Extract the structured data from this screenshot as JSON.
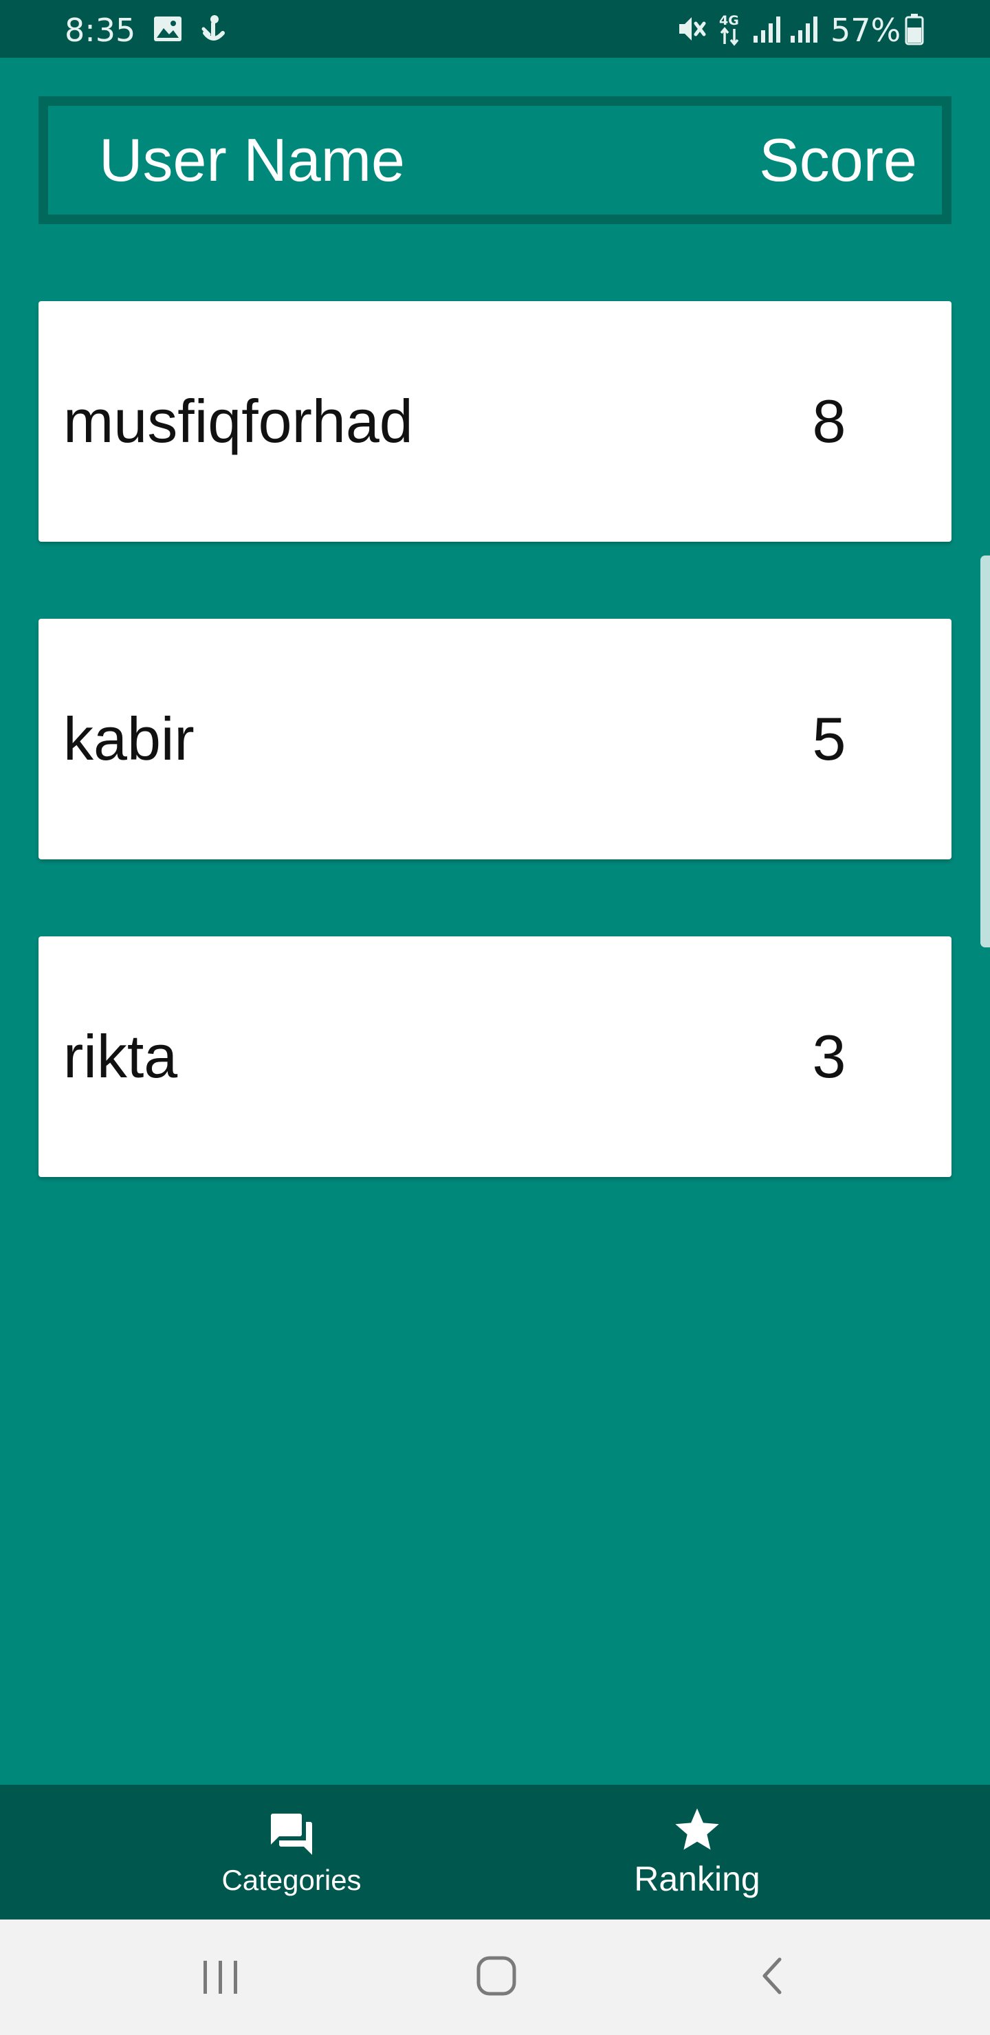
{
  "status_bar": {
    "time": "8:35",
    "battery_percent": "57%",
    "network_type": "4G",
    "icons": [
      "gallery-icon",
      "anchor-notification-icon",
      "mute-icon",
      "network-4g-icon",
      "signal-1-icon",
      "signal-2-icon",
      "battery-icon"
    ]
  },
  "table_header": {
    "user_label": "User Name",
    "score_label": "Score"
  },
  "rankings": [
    {
      "name": "musfiqforhad",
      "score": "8"
    },
    {
      "name": "kabir",
      "score": "5"
    },
    {
      "name": "rikta",
      "score": "3"
    }
  ],
  "bottom_nav": {
    "items": [
      {
        "label": "Categories",
        "icon": "forum-icon",
        "selected": false
      },
      {
        "label": "Ranking",
        "icon": "star-icon",
        "selected": true
      }
    ]
  },
  "system_nav": {
    "buttons": [
      "recent-apps",
      "home",
      "back"
    ]
  },
  "colors": {
    "primary": "#00897b",
    "primary_dark": "#00574e",
    "header_border": "#00695c",
    "card": "#ffffff",
    "system_nav_bg": "#f2f2f2"
  }
}
